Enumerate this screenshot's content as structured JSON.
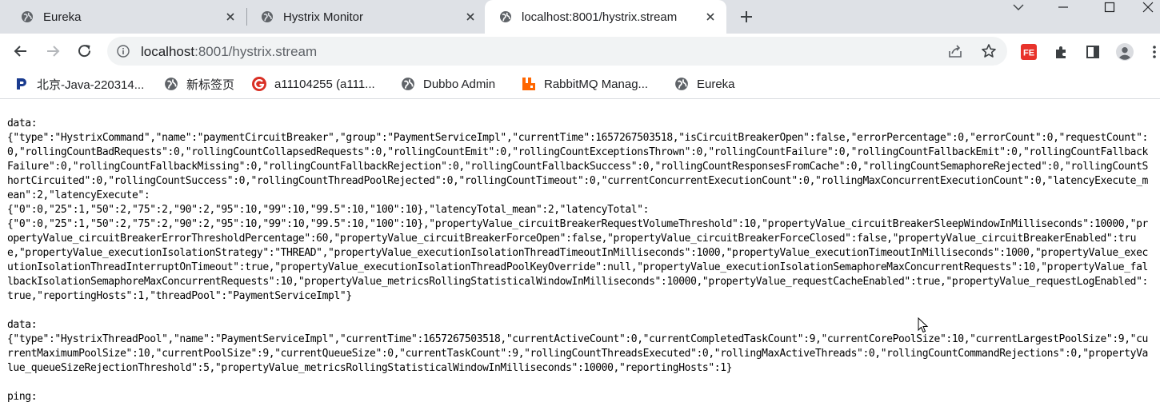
{
  "tabs": [
    {
      "title": "Eureka",
      "active": false
    },
    {
      "title": "Hystrix Monitor",
      "active": false
    },
    {
      "title": "localhost:8001/hystrix.stream",
      "active": true
    }
  ],
  "address_bar": {
    "host": "localhost",
    "rest": ":8001/hystrix.stream"
  },
  "bookmarks": [
    {
      "label": "北京-Java-220314...",
      "icon": "p-logo-icon"
    },
    {
      "label": "新标签页",
      "icon": "globe-icon"
    },
    {
      "label": "a11104255 (a111...",
      "icon": "g-logo-icon"
    },
    {
      "label": "Dubbo Admin",
      "icon": "globe-icon"
    },
    {
      "label": "RabbitMQ Manag...",
      "icon": "rabbitmq-icon"
    },
    {
      "label": "Eureka",
      "icon": "globe-icon"
    }
  ],
  "extension_label": "FE",
  "colors": {
    "tab_strip": "#dee1e6",
    "omnibox": "#f1f3f4",
    "p_logo": "#1a3b8f",
    "g_logo": "#d93025",
    "rabbitmq": "#ff6600",
    "fe_ext": "#e8332b"
  },
  "stream_text": "data:\n{\"type\":\"HystrixCommand\",\"name\":\"paymentCircuitBreaker\",\"group\":\"PaymentServiceImpl\",\"currentTime\":1657267503518,\"isCircuitBreakerOpen\":false,\"errorPercentage\":0,\"errorCount\":0,\"requestCount\":0,\"rollingCountBadRequests\":0,\"rollingCountCollapsedRequests\":0,\"rollingCountEmit\":0,\"rollingCountExceptionsThrown\":0,\"rollingCountFailure\":0,\"rollingCountFallbackEmit\":0,\"rollingCountFallbackFailure\":0,\"rollingCountFallbackMissing\":0,\"rollingCountFallbackRejection\":0,\"rollingCountFallbackSuccess\":0,\"rollingCountResponsesFromCache\":0,\"rollingCountSemaphoreRejected\":0,\"rollingCountShortCircuited\":0,\"rollingCountSuccess\":0,\"rollingCountThreadPoolRejected\":0,\"rollingCountTimeout\":0,\"currentConcurrentExecutionCount\":0,\"rollingMaxConcurrentExecutionCount\":0,\"latencyExecute_mean\":2,\"latencyExecute\":\n{\"0\":0,\"25\":1,\"50\":2,\"75\":2,\"90\":2,\"95\":10,\"99\":10,\"99.5\":10,\"100\":10},\"latencyTotal_mean\":2,\"latencyTotal\":\n{\"0\":0,\"25\":1,\"50\":2,\"75\":2,\"90\":2,\"95\":10,\"99\":10,\"99.5\":10,\"100\":10},\"propertyValue_circuitBreakerRequestVolumeThreshold\":10,\"propertyValue_circuitBreakerSleepWindowInMilliseconds\":10000,\"propertyValue_circuitBreakerErrorThresholdPercentage\":60,\"propertyValue_circuitBreakerForceOpen\":false,\"propertyValue_circuitBreakerForceClosed\":false,\"propertyValue_circuitBreakerEnabled\":true,\"propertyValue_executionIsolationStrategy\":\"THREAD\",\"propertyValue_executionIsolationThreadTimeoutInMilliseconds\":1000,\"propertyValue_executionTimeoutInMilliseconds\":1000,\"propertyValue_executionIsolationThreadInterruptOnTimeout\":true,\"propertyValue_executionIsolationThreadPoolKeyOverride\":null,\"propertyValue_executionIsolationSemaphoreMaxConcurrentRequests\":10,\"propertyValue_fallbackIsolationSemaphoreMaxConcurrentRequests\":10,\"propertyValue_metricsRollingStatisticalWindowInMilliseconds\":10000,\"propertyValue_requestCacheEnabled\":true,\"propertyValue_requestLogEnabled\":true,\"reportingHosts\":1,\"threadPool\":\"PaymentServiceImpl\"}\n\ndata:\n{\"type\":\"HystrixThreadPool\",\"name\":\"PaymentServiceImpl\",\"currentTime\":1657267503518,\"currentActiveCount\":0,\"currentCompletedTaskCount\":9,\"currentCorePoolSize\":10,\"currentLargestPoolSize\":9,\"currentMaximumPoolSize\":10,\"currentPoolSize\":9,\"currentQueueSize\":0,\"currentTaskCount\":9,\"rollingCountThreadsExecuted\":0,\"rollingMaxActiveThreads\":0,\"rollingCountCommandRejections\":0,\"propertyValue_queueSizeRejectionThreshold\":5,\"propertyValue_metricsRollingStatisticalWindowInMilliseconds\":10000,\"reportingHosts\":1}\n\nping:"
}
